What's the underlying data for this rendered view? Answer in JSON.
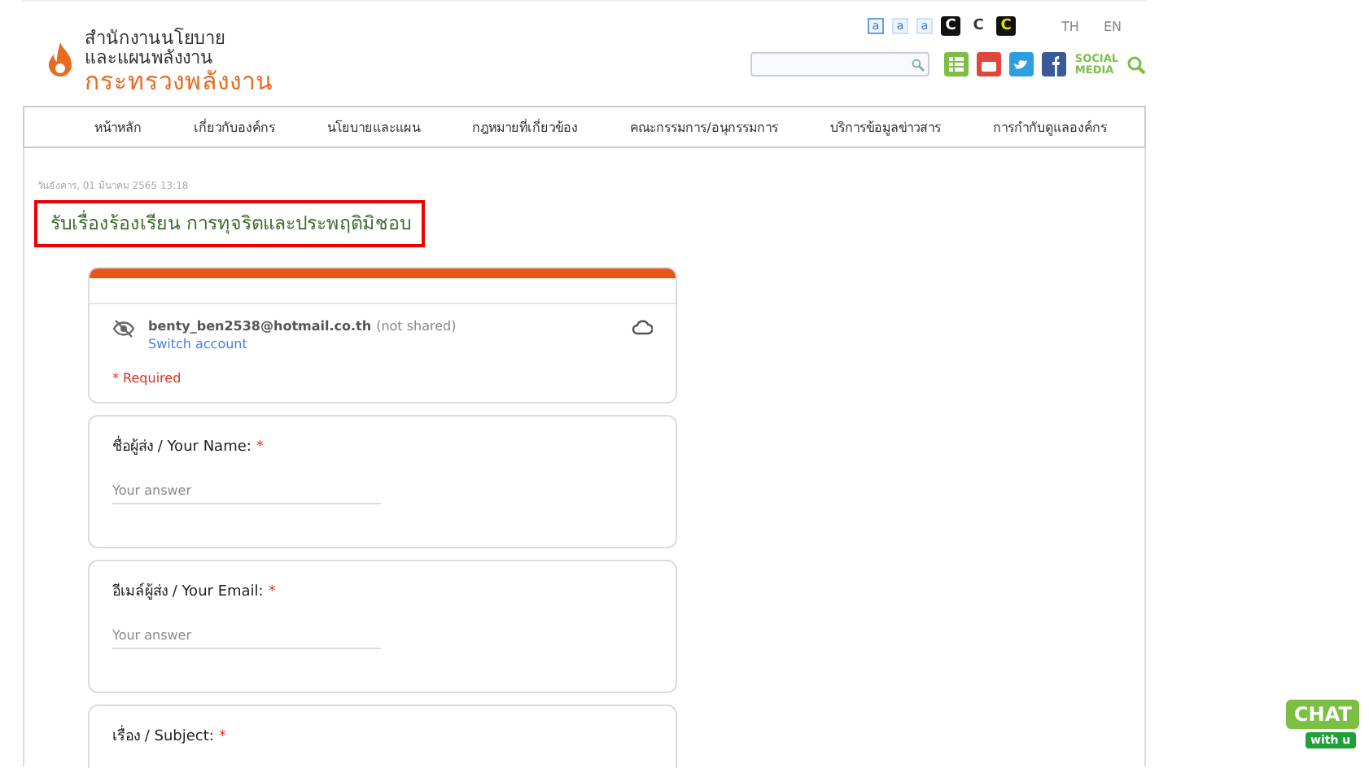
{
  "header": {
    "logo_lines": [
      "สำนักงานนโยบาย",
      "และแผนพลังงาน"
    ],
    "logo_ministry": "กระทรวงพลังงาน",
    "font_sizes": [
      {
        "label": "a",
        "selected": true
      },
      {
        "label": "a",
        "selected": false
      },
      {
        "label": "a",
        "selected": false
      }
    ],
    "contrast": [
      {
        "label": "C",
        "kind": "dark"
      },
      {
        "label": "C",
        "kind": "plain"
      },
      {
        "label": "C",
        "kind": "yellow"
      }
    ],
    "languages": [
      {
        "label": "TH",
        "selected": false
      },
      {
        "label": "EN",
        "selected": false
      }
    ],
    "social_label": [
      "SOCIAL",
      "MEDIA"
    ]
  },
  "nav": [
    "หน้าหลัก",
    "เกี่ยวกับองค์กร",
    "นโยบายและแผน",
    "กฎหมายที่เกี่ยวข้อง",
    "คณะกรรมการ/อนุกรรมการ",
    "บริการข้อมูลข่าวสาร",
    "การกำกับดูแลองค์กร"
  ],
  "date": "วันอังคาร, 01 มีนาคม 2565 13:18",
  "title": "รับเรื่องร้องเรียน การทุจริตและประพฤติมิชอบ",
  "form": {
    "account": "benty_ben2538@hotmail.co.th",
    "not_shared": "(not shared)",
    "switch": "Switch account",
    "required_note": "* Required",
    "questions": [
      {
        "label": "ชื่อผู้ส่ง / Your Name:",
        "required_mark": "*",
        "placeholder": "Your answer"
      },
      {
        "label": "อีเมล์ผู้ส่ง / Your Email:",
        "required_mark": "*",
        "placeholder": "Your answer"
      },
      {
        "label": "เรื่อง / Subject:",
        "required_mark": "*"
      }
    ]
  },
  "chat": {
    "title": "CHAT",
    "subtitle": "with u"
  }
}
